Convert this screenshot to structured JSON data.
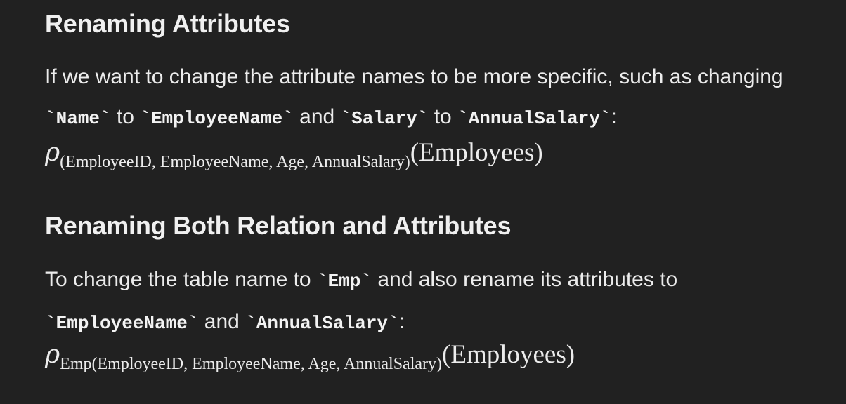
{
  "section1": {
    "heading": "Renaming Attributes",
    "para_line1": "If we want to change the attribute names to be more specific, such as changing",
    "tick": "`",
    "code_name": "Name",
    "word_to": " to ",
    "code_employee_name": "EmployeeName",
    "word_and": " and ",
    "code_salary": "Salary",
    "code_annual_salary": "AnnualSalary",
    "colon": ":",
    "formula": {
      "symbol": "ρ",
      "subscript": "(EmployeeID, EmployeeName, Age, AnnualSalary)",
      "argument": "(Employees)"
    }
  },
  "section2": {
    "heading": "Renaming Both Relation and Attributes",
    "para_text1": "To change the table name to ",
    "code_emp": "Emp",
    "para_text2": " and also rename its attributes to",
    "code_employee_name": "EmployeeName",
    "word_and": " and ",
    "code_annual_salary": "AnnualSalary",
    "colon": ":",
    "formula": {
      "symbol": "ρ",
      "subscript": "Emp(EmployeeID, EmployeeName, Age, AnnualSalary)",
      "argument": "(Employees)"
    }
  }
}
